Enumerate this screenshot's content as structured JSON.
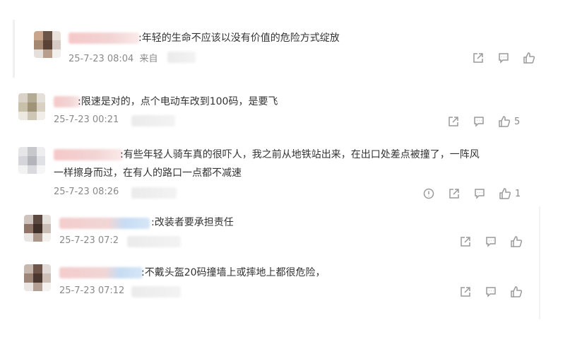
{
  "comments": [
    {
      "text": ":年轻的生命不应该以没有价值的危险方式绽放",
      "time": "25-7-23 08:04",
      "source_prefix": "来自",
      "like_count": ""
    },
    {
      "text": ":限速是对的，点个电动车改到100码，是要飞",
      "time": "25-7-23 00:21",
      "like_count": "5"
    },
    {
      "text_line1": ":有些年轻人骑车真的很吓人，我之前从地铁站出来，在出口处差点被撞了，一阵风",
      "text_line2": "一样擦身而过，在有人的路口一点都不减速",
      "time": "25-7-23 08:26",
      "like_count": "1"
    },
    {
      "text": ":改装者要承担责任",
      "time": "25-7-23 07:2",
      "like_count": ""
    },
    {
      "text": ":不戴头盔20码撞墙上或摔地上都很危险，",
      "time": "25-7-23 07:12",
      "like_count": ""
    }
  ],
  "icons": {
    "share": "share-icon",
    "reply": "comment-icon",
    "like": "thumbs-up-icon",
    "report": "report-icon"
  },
  "colors": {
    "text": "#333333",
    "meta": "#8a8a8a",
    "icon": "#9a9a9a"
  }
}
